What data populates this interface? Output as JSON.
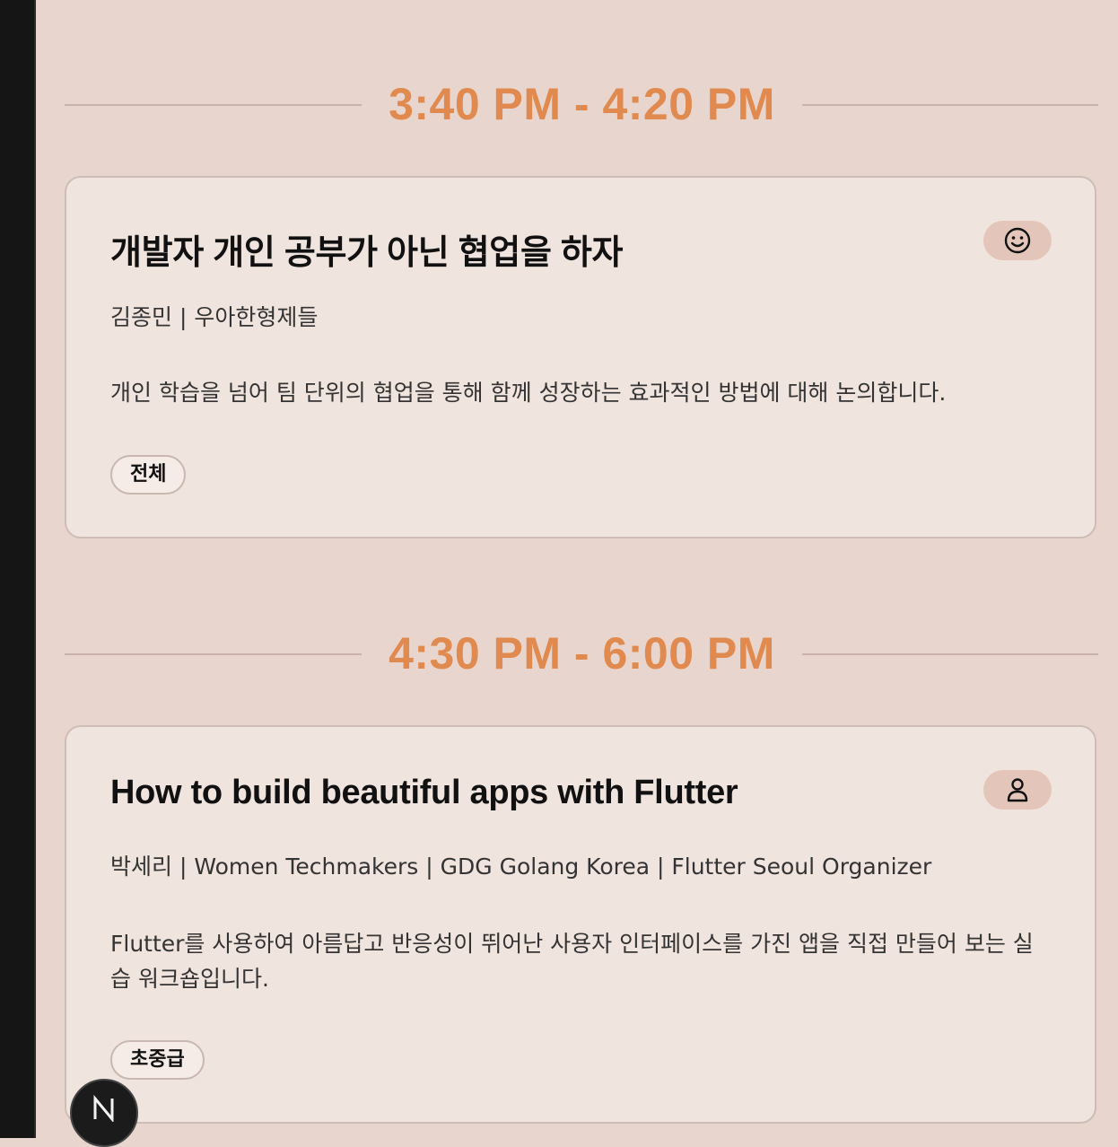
{
  "sessions": [
    {
      "time": "3:40 PM - 4:20 PM",
      "title": "개발자 개인 공부가 아닌 협업을 하자",
      "icon": "smiley-icon",
      "speaker": "김종민 | 우아한형제들",
      "description": "개인 학습을 넘어 팀 단위의 협업을 통해 함께 성장하는 효과적인 방법에 대해 논의합니다.",
      "tag": "전체"
    },
    {
      "time": "4:30 PM - 6:00 PM",
      "title": "How to build beautiful apps with Flutter",
      "icon": "user-icon",
      "speaker": "박세리 | Women Techmakers | GDG Golang Korea | Flutter Seoul Organizer",
      "description": "Flutter를 사용하여 아름답고 반응성이 뛰어난 사용자 인터페이스를 가진 앱을 직접 만들어 보는 실습 워크숍입니다.",
      "tag": "초중급"
    }
  ],
  "colors": {
    "background": "#e8d6ce",
    "card": "#f0e4de",
    "time_accent": "#e08a4f",
    "icon_pill": "#e3c6b9"
  },
  "devtools_badge": {
    "icon": "next-logo-icon"
  }
}
